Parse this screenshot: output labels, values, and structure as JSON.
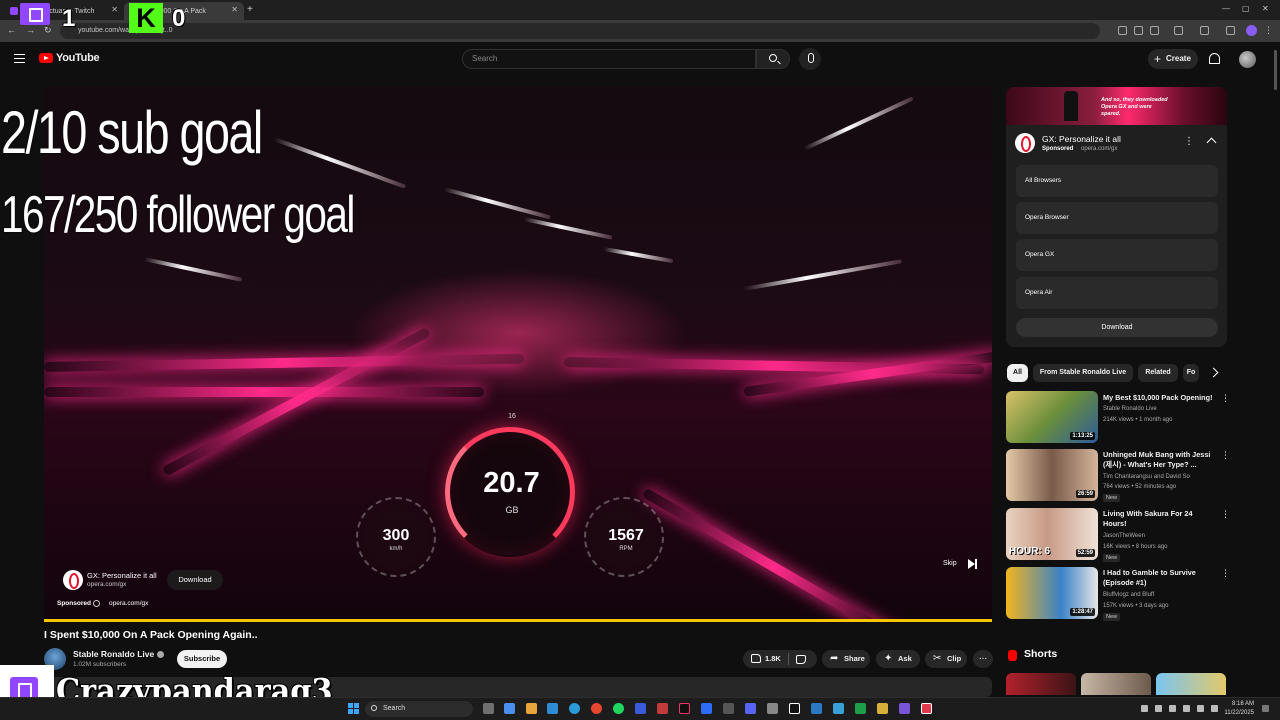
{
  "browser": {
    "tabs": [
      {
        "label": "vexSanctuary - Twitch"
      },
      {
        "label": "$10,000 On A Pack"
      }
    ],
    "url": "youtube.com/wa...(.....7fX0jt..0"
  },
  "header": {
    "logo_text": "YouTube",
    "search_placeholder": "Search",
    "create_label": "Create"
  },
  "stream_overlay": {
    "sub_goal": "2/10 sub goal",
    "follower_goal": "167/250 follower goal",
    "counter_left": "1",
    "kick_letter": "K",
    "counter_right": "0",
    "streamer_name": "Crazypandarag3"
  },
  "player": {
    "hud": {
      "speed": "20.7",
      "speed_unit": "GB",
      "tick": "16",
      "left_gauge": "300",
      "left_unit": "km/h",
      "right_gauge": "1567",
      "right_unit": "RPM"
    },
    "ad": {
      "title": "GX: Personalize it all",
      "url": "opera.com/gx",
      "download_label": "Download",
      "sponsored_label": "Sponsored",
      "domain": "opera.com/gx",
      "skip_label": "Skip"
    }
  },
  "video": {
    "title": "I Spent $10,000 On A Pack Opening Again..",
    "channel": "Stable Ronaldo Live",
    "subscribers": "1.02M subscribers",
    "subscribe_label": "Subscribe",
    "likes": "1.8K",
    "share_label": "Share",
    "ask_label": "Ask",
    "clip_label": "Clip",
    "more_label": "..."
  },
  "sidebar": {
    "ad_banner_text": "And so, they downloaded Opera GX and were spared.",
    "ad_panel": {
      "title": "GX: Personalize it all",
      "sponsored": "Sponsored",
      "domain": "opera.com/gx",
      "options": [
        "All Browsers",
        "Opera Browser",
        "Opera GX",
        "Opera Air"
      ],
      "download_label": "Download"
    },
    "chips": [
      "All",
      "From Stable Ronaldo Live",
      "Related",
      "Fo"
    ],
    "recommendations": [
      {
        "title": "My Best $10,000 Pack Opening!",
        "channel": "Stable Ronaldo Live",
        "meta": "214K views • 1 month ago",
        "duration": "1:13:25",
        "badge": ""
      },
      {
        "title": "Unhinged Muk Bang with Jessi (제시) - What's Her Type? ...",
        "channel": "Tim Chantarangsu and David So",
        "meta": "764 views • 52 minutes ago",
        "duration": "26:59",
        "badge": "New"
      },
      {
        "title": "Living With Sakura For 24 Hours!",
        "channel": "JasonTheWeen",
        "meta": "16K views • 8 hours ago",
        "duration": "52:59",
        "badge": "New",
        "thumb_text": "HOUR: 6"
      },
      {
        "title": "I Had to Gamble to Survive (Episode #1)",
        "channel": "Bluffvlogz and Bluff",
        "meta": "157K views • 3 days ago",
        "duration": "1:28:47",
        "badge": "New"
      }
    ],
    "shorts_label": "Shorts"
  },
  "taskbar": {
    "search_label": "Search",
    "time": "8:18 AM",
    "date": "11/22/2025"
  },
  "colors": {
    "accent": "#ff0000",
    "twitch": "#9146ff",
    "kick": "#53fc18",
    "progress": "#f9c700"
  }
}
